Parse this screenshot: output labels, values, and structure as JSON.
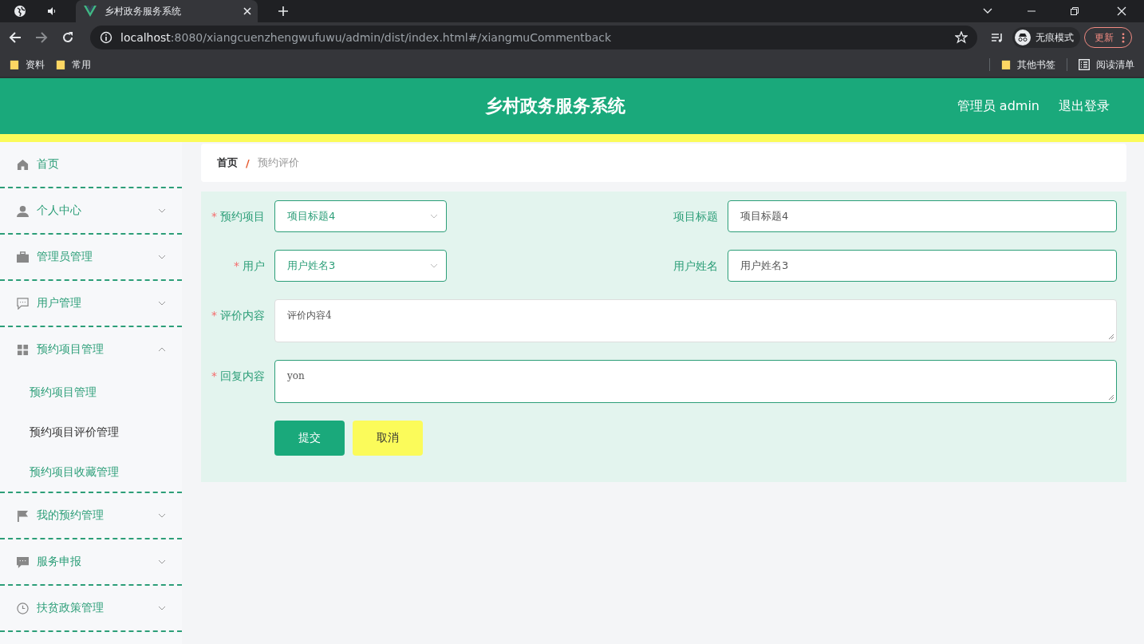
{
  "browser": {
    "tab": {
      "title": "乡村政务服务系统"
    },
    "url_host": "localhost",
    "url_path": ":8080/xiangcuenzhengwufuwu/admin/dist/index.html#/xiangmuCommentback",
    "profile": "无痕模式",
    "update": "更新",
    "bookmarks": [
      "资料",
      "常用"
    ],
    "bookmarks_right": [
      {
        "kind": "folder",
        "label": "其他书签"
      },
      {
        "kind": "list",
        "label": "阅读清单"
      }
    ]
  },
  "header": {
    "title": "乡村政务服务系统",
    "user": "管理员 admin",
    "logout": "退出登录"
  },
  "sidebar": {
    "items": [
      {
        "kind": "home",
        "label": "首页"
      },
      {
        "kind": "person",
        "label": "个人中心",
        "expanded": false
      },
      {
        "kind": "case",
        "label": "管理员管理",
        "expanded": false
      },
      {
        "kind": "chat",
        "label": "用户管理",
        "expanded": false
      },
      {
        "kind": "grid",
        "label": "预约项目管理",
        "expanded": true,
        "children": [
          {
            "label": "预约项目管理",
            "selected": false
          },
          {
            "label": "预约项目评价管理",
            "selected": true
          },
          {
            "label": "预约项目收藏管理",
            "selected": false
          }
        ]
      },
      {
        "kind": "flag",
        "label": "我的预约管理",
        "expanded": false
      },
      {
        "kind": "message",
        "label": "服务申报",
        "expanded": false
      },
      {
        "kind": "clock",
        "label": "扶贫政策管理",
        "expanded": false
      }
    ]
  },
  "breadcrumb": [
    "首页",
    "预约评价"
  ],
  "breadcrumb_separator": "/",
  "form": {
    "required_mark": "*",
    "rows": [
      [
        {
          "kind": "select",
          "label": "预约项目",
          "required": true,
          "value": "项目标题4"
        },
        {
          "kind": "input",
          "label": "项目标题",
          "required": false,
          "value": "项目标题4"
        }
      ],
      [
        {
          "kind": "select",
          "label": "用户",
          "required": true,
          "value": "用户姓名3"
        },
        {
          "kind": "input",
          "label": "用户姓名",
          "required": false,
          "value": "用户姓名3"
        }
      ],
      [
        {
          "kind": "textarea",
          "label": "评价内容",
          "required": true,
          "value": "评价内容4",
          "readonly": true
        }
      ],
      [
        {
          "kind": "textarea",
          "label": "回复内容",
          "required": true,
          "value": "yon",
          "readonly": false
        }
      ]
    ],
    "buttons": [
      {
        "kind": "primary",
        "label": "提交"
      },
      {
        "kind": "cancel",
        "label": "取消"
      }
    ]
  }
}
